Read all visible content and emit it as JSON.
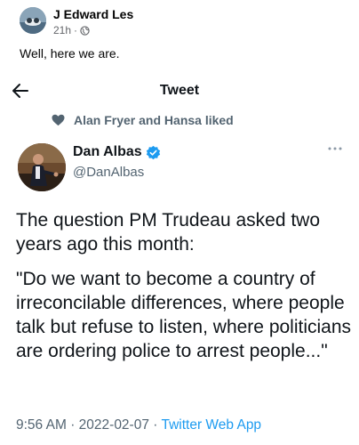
{
  "fb_post": {
    "author": "J Edward Les",
    "time": "21h",
    "separator": "·",
    "text": "Well, here we are.",
    "avatar_icon": "profile-photo",
    "privacy_icon": "globe-icon"
  },
  "tweet": {
    "header_title": "Tweet",
    "back_icon": "arrow-left-icon",
    "liked_text": "Alan Fryer and Hansa liked",
    "liked_icon": "heart-icon",
    "display_name": "Dan Albas",
    "handle": "@DanAlbas",
    "verified": true,
    "more_icon": "ellipsis-icon",
    "paragraph_1": "The question PM Trudeau asked two years ago this month:",
    "paragraph_2": "\"Do we want to become a country of irreconcilable differences, where people talk but refuse to listen, where politicians are ordering police to arrest people...\"",
    "time": "9:56 AM",
    "date": "2022-02-07",
    "separator": "·",
    "source": "Twitter Web App"
  },
  "colors": {
    "twitter_blue": "#1d9bf0",
    "secondary_text": "#536471",
    "primary_text": "#0f1419",
    "facebook_meta": "#65676b"
  }
}
